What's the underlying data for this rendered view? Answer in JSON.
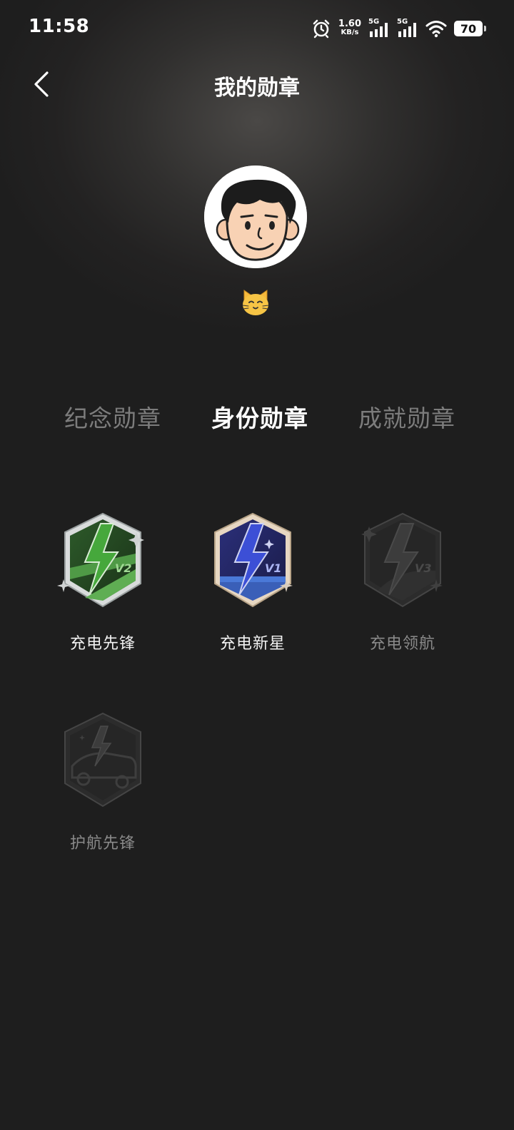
{
  "status_bar": {
    "time": "11:58",
    "net_speed_value": "1.60",
    "net_speed_unit": "KB/s",
    "sim1_label": "5G",
    "sim2_label": "5G",
    "battery": "70",
    "icons": [
      "alarm-icon",
      "signal-icon",
      "signal-icon",
      "wifi-icon",
      "battery-icon"
    ]
  },
  "header": {
    "title": "我的勋章",
    "back_icon": "chevron-left-icon"
  },
  "profile": {
    "avatar": "cartoon-face-avatar",
    "emoji": "cat-face-icon"
  },
  "tabs": [
    {
      "label": "纪念勋章",
      "active": false
    },
    {
      "label": "身份勋章",
      "active": true
    },
    {
      "label": "成就勋章",
      "active": false
    }
  ],
  "badges": [
    {
      "label": "充电先锋",
      "tier": "V2",
      "unlocked": true,
      "color": "#3f9a3a"
    },
    {
      "label": "充电新星",
      "tier": "V1",
      "unlocked": true,
      "color": "#3a46c8"
    },
    {
      "label": "充电领航",
      "tier": "V3",
      "unlocked": false,
      "color": "#4a4a4a"
    },
    {
      "label": "护航先锋",
      "tier": "",
      "unlocked": false,
      "color": "#4a4a4a"
    }
  ],
  "colors": {
    "background": "#1e1e1e",
    "text_primary": "#ffffff",
    "text_inactive": "#7c7c7c",
    "text_locked": "#8a8a8a"
  }
}
